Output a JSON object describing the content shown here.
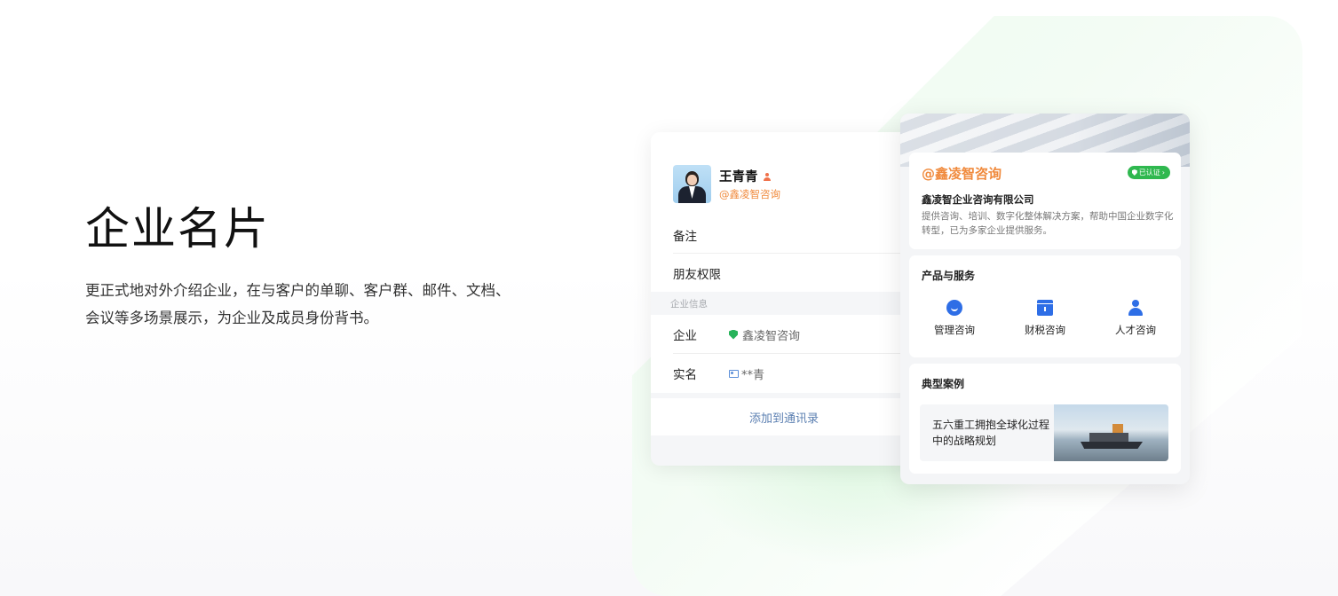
{
  "hero": {
    "title": "企业名片",
    "description": "更正式地对外介绍企业，在与客户的单聊、客户群、邮件、文档、会议等多场景展示，为企业及成员身份背书。"
  },
  "contact_card": {
    "name": "王青青",
    "company_tag": "@鑫凌智咨询",
    "rows": [
      {
        "label": "备注"
      },
      {
        "label": "朋友权限"
      }
    ],
    "section_label": "企业信息",
    "info": {
      "enterprise_label": "企业",
      "enterprise_value": "鑫凌智咨询",
      "realname_label": "实名",
      "realname_value": "**青"
    },
    "add_button": "添加到通讯录"
  },
  "enterprise_card": {
    "name": "@鑫凌智咨询",
    "verified_label": "已认证",
    "full_name": "鑫凌智企业咨询有限公司",
    "description": "提供咨询、培训、数字化整体解决方案，帮助中国企业数字化转型，已为多家企业提供服务。",
    "products_title": "产品与服务",
    "services": [
      {
        "label": "管理咨询",
        "icon": "chat-icon"
      },
      {
        "label": "财税咨询",
        "icon": "box-icon"
      },
      {
        "label": "人才咨询",
        "icon": "user-icon"
      }
    ],
    "cases_title": "典型案例",
    "case_text": "五六重工拥抱全球化过程中的战略规划"
  },
  "colors": {
    "accent_orange": "#f08a3c",
    "verified_green": "#2fb84f",
    "icon_blue": "#2e6ee6",
    "link_blue": "#5b7fb1"
  }
}
